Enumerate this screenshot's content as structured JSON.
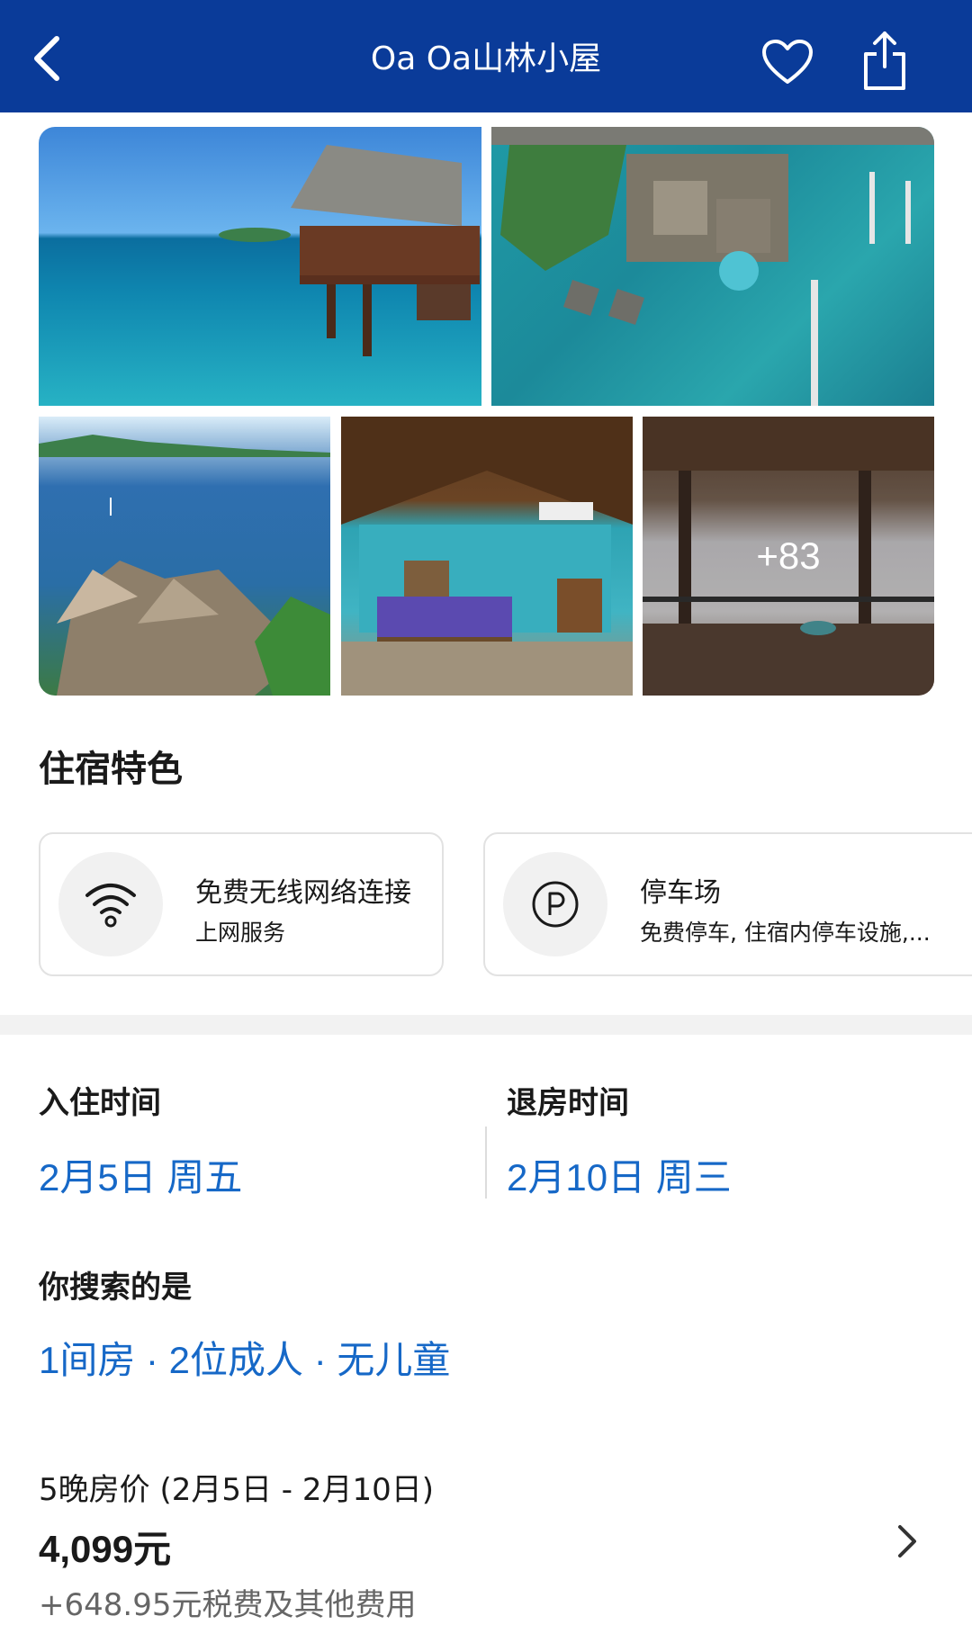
{
  "header": {
    "title": "Oa Oa山林小屋",
    "background": "#0a3b99",
    "icons": [
      "chevron-left-icon",
      "heart-icon",
      "share-icon"
    ]
  },
  "gallery": {
    "more_count": "+83"
  },
  "features": {
    "title": "住宿特色",
    "items": [
      {
        "icon": "wifi-icon",
        "title": "免费无线网络连接",
        "subtitle": "上网服务"
      },
      {
        "icon": "parking-icon",
        "title": "停车场",
        "subtitle": "免费停车, 住宿内停车设施,..."
      }
    ]
  },
  "stay": {
    "checkin_label": "入住时间",
    "checkin_value": "2月5日 周五",
    "checkout_label": "退房时间",
    "checkout_value": "2月10日 周三",
    "search_label": "你搜索的是",
    "search_value": "1间房 · 2位成人 · 无儿童"
  },
  "price": {
    "caption": "5晚房价 (2月5日 - 2月10日)",
    "total": "4,099元",
    "extra": "+648.95元税费及其他费用"
  },
  "colors": {
    "accent": "#1668c7",
    "header": "#0a3b99"
  }
}
